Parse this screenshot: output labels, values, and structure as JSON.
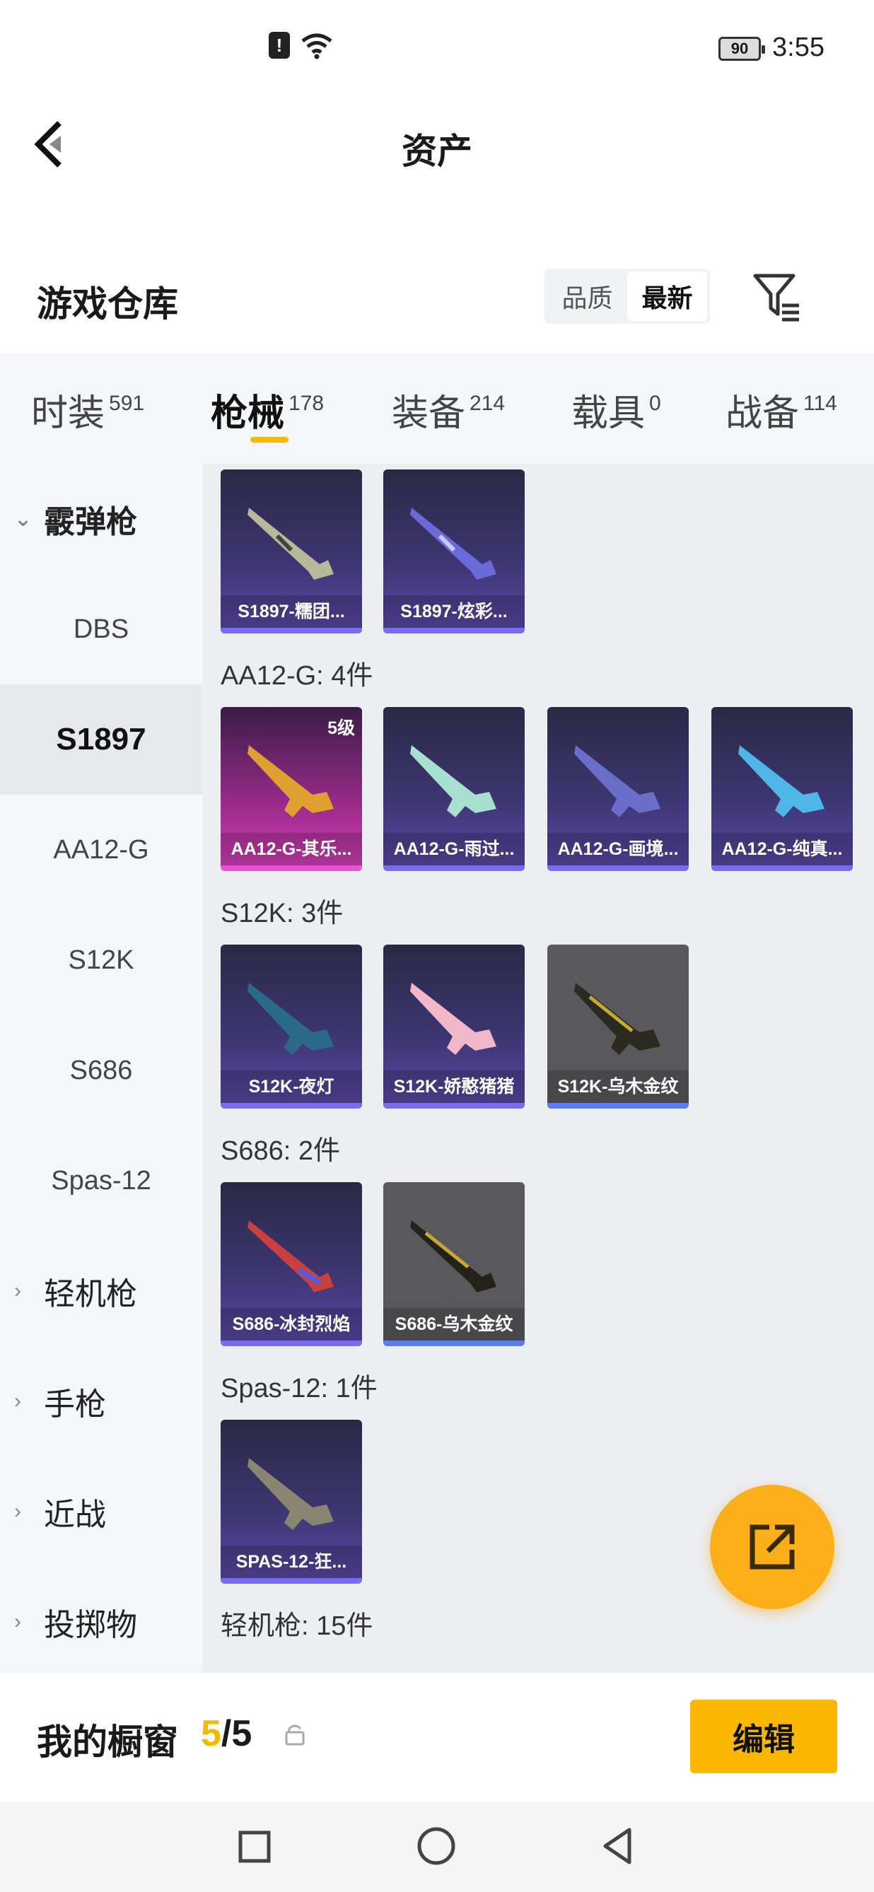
{
  "status_bar": {
    "time": "3:55",
    "battery": "90"
  },
  "header": {
    "title": "资产"
  },
  "section": {
    "title": "游戏仓库",
    "sort_quality": "品质",
    "sort_newest": "最新"
  },
  "tabs": [
    {
      "label": "时装",
      "count": "591"
    },
    {
      "label": "枪械",
      "count": "178"
    },
    {
      "label": "装备",
      "count": "214"
    },
    {
      "label": "载具",
      "count": "0"
    },
    {
      "label": "战备",
      "count": "114"
    }
  ],
  "sidebar": {
    "shotgun_group": "霰弹枪",
    "items": [
      "DBS",
      "S1897",
      "AA12-G",
      "S12K",
      "S686",
      "Spas-12"
    ],
    "groups": [
      "轻机枪",
      "手枪",
      "近战",
      "投掷物"
    ]
  },
  "content": {
    "s1897_items": [
      "S1897-糯团...",
      "S1897-炫彩..."
    ],
    "aa12_label": "AA12-G: 4件",
    "aa12_items": [
      "AA12-G-其乐...",
      "AA12-G-雨过...",
      "AA12-G-画境...",
      "AA12-G-纯真..."
    ],
    "aa12_level": "5级",
    "s12k_label": "S12K: 3件",
    "s12k_items": [
      "S12K-夜灯",
      "S12K-娇憨猪猪",
      "S12K-乌木金纹"
    ],
    "s686_label": "S686: 2件",
    "s686_items": [
      "S686-冰封烈焰",
      "S686-乌木金纹"
    ],
    "spas_label": "Spas-12: 1件",
    "spas_items": [
      "SPAS-12-狂..."
    ],
    "lmg_label": "轻机枪: 15件"
  },
  "bottom": {
    "label": "我的橱窗",
    "current": "5",
    "sep": "/",
    "total": "5",
    "edit": "编辑"
  },
  "colors": {
    "accent": "#f5b800",
    "fab": "#fbb01a"
  }
}
